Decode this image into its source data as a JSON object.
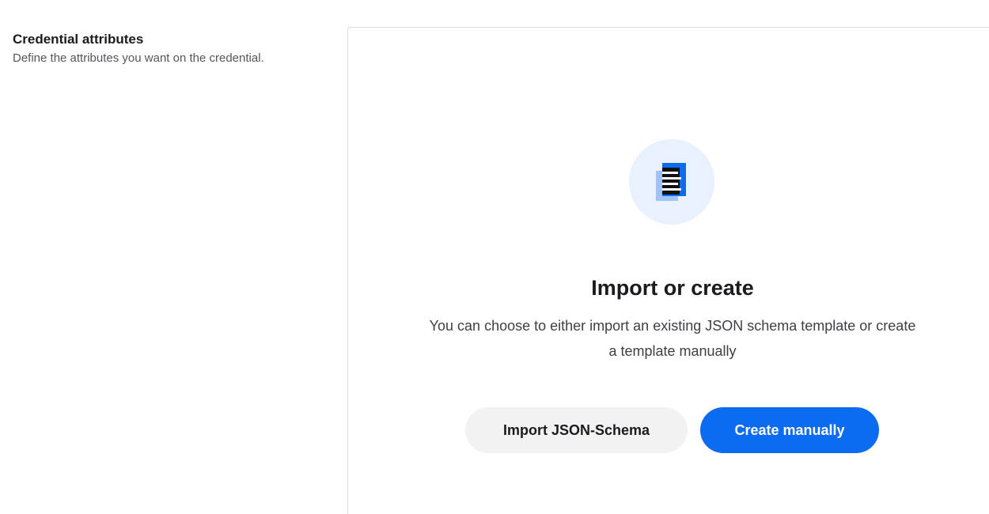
{
  "section": {
    "title": "Credential attributes",
    "description": "Define the attributes you want on the credential."
  },
  "empty_state": {
    "icon": "document-stack-icon",
    "title": "Import or create",
    "description": "You can choose to either import an existing JSON schema template or create a template manually",
    "import_button_label": "Import JSON-Schema",
    "create_button_label": "Create manually"
  },
  "colors": {
    "primary": "#0b6cf2",
    "icon_background": "#e8f1fd",
    "secondary_button": "#f2f2f3"
  }
}
